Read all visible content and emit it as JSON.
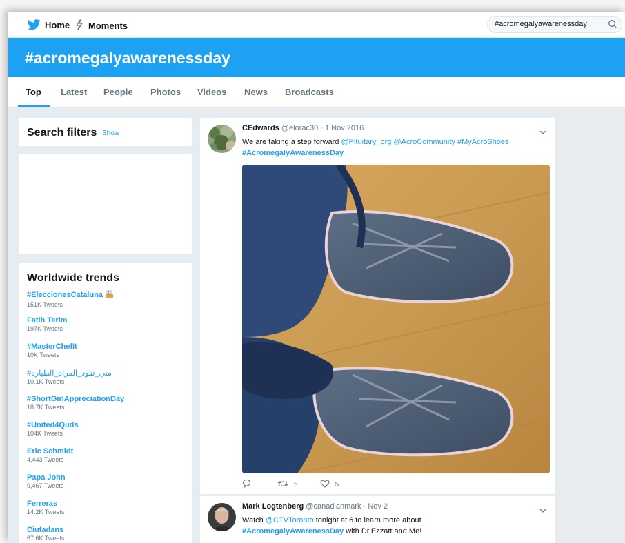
{
  "topnav": {
    "home_label": "Home",
    "moments_label": "Moments",
    "search_value": "#acromegalyawarenessday",
    "icons": [
      "twitter-bird-icon",
      "moments-bolt-icon",
      "search-icon"
    ]
  },
  "banner": {
    "title": "#acromegalyawarenessday"
  },
  "tabs": [
    {
      "label": "Top",
      "active": true
    },
    {
      "label": "Latest"
    },
    {
      "label": "People"
    },
    {
      "label": "Photos"
    },
    {
      "label": "Videos"
    },
    {
      "label": "News"
    },
    {
      "label": "Broadcasts"
    }
  ],
  "search_filters": {
    "title": "Search filters",
    "separator": "·",
    "show_label": "Show"
  },
  "trends": {
    "title": "Worldwide trends",
    "items": [
      {
        "name": "#EleccionesCataluna",
        "count": "151K Tweets"
      },
      {
        "name": "Fatih Terim",
        "count": "197K Tweets"
      },
      {
        "name": "#MasterChefIt",
        "count": "10K Tweets"
      },
      {
        "name": "#متي_تقود_المراه_الطياره",
        "count": "10.1K Tweets"
      },
      {
        "name": "#ShortGirlAppreciationDay",
        "count": "18.7K Tweets"
      },
      {
        "name": "#United4Quds",
        "count": "104K Tweets"
      },
      {
        "name": "Eric Schmidt",
        "count": "4,443 Tweets"
      },
      {
        "name": "Papa John",
        "count": "9,467 Tweets"
      },
      {
        "name": "Ferreras",
        "count": "14.2K Tweets"
      },
      {
        "name": "Ciutadans",
        "count": "67.6K Tweets"
      }
    ]
  },
  "tweets": [
    {
      "name": "CEdwards",
      "meta": "@elorac30 · 1 Nov 2016",
      "text_plain": "We are taking a step forward ",
      "mention1": "@Pituitary_org",
      "mention2": "@AcroCommunity",
      "hashtag1": "#MyAcroShoes",
      "hashtag2": "#AcromegalyAwarenessDay",
      "retweets": "5",
      "likes": "5"
    },
    {
      "name": "Mark Logtenberg",
      "meta": "@canadianmark · Nov 2",
      "text_plain": "Watch ",
      "mention1": "@CTVToronto",
      "text_after": " tonight at 6 to learn more about",
      "hashtag1": "#AcromegalyAwarenessDay",
      "text_end": " with Dr.Ezzatt and Me!"
    }
  ],
  "colors": {
    "accent": "#1da1f2",
    "bg": "#e6ecf0",
    "text": "#14171a",
    "muted": "#657786"
  }
}
